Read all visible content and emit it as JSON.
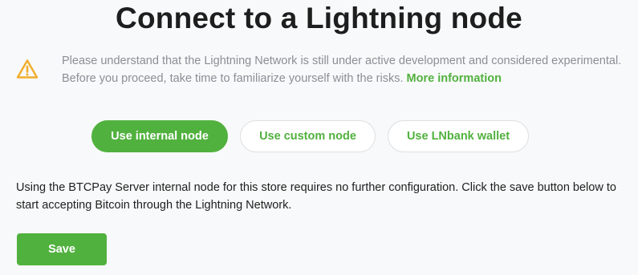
{
  "page": {
    "title": "Connect to a Lightning node"
  },
  "alert": {
    "icon": "warning-icon",
    "icon_color": "#f0ad2b",
    "text": "Please understand that the Lightning Network is still under active development and considered experimental. Before you proceed, take time to familiarize yourself with the risks.",
    "link_label": "More information"
  },
  "node_options": {
    "selected": "Use internal node",
    "items": [
      {
        "label": "Use internal node"
      },
      {
        "label": "Use custom node"
      },
      {
        "label": "Use LNbank wallet"
      }
    ]
  },
  "description": "Using the BTCPay Server internal node for this store requires no further configuration. Click the save button below to start accepting Bitcoin through the Lightning Network.",
  "actions": {
    "save_label": "Save"
  },
  "colors": {
    "accent": "#51b13e",
    "warning": "#f0ad2b",
    "muted_text": "#8a8f95",
    "background": "#f8f9fa"
  }
}
